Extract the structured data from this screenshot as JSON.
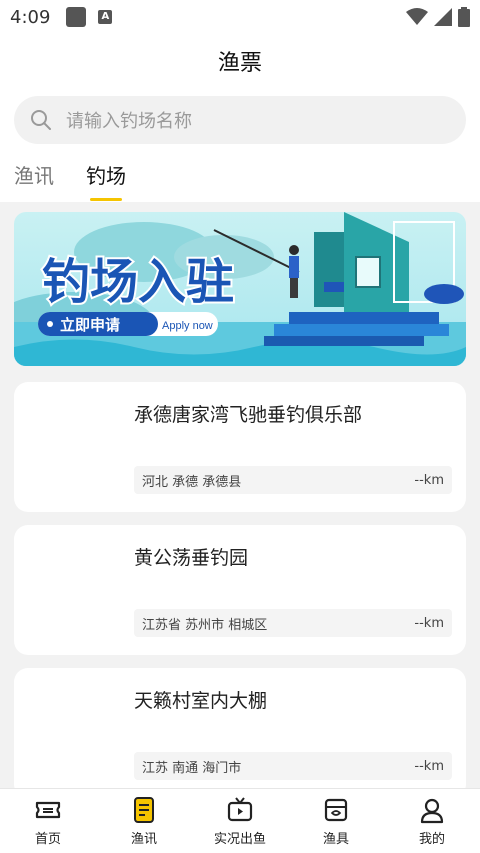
{
  "status": {
    "time": "4:09"
  },
  "header": {
    "title": "渔票"
  },
  "search": {
    "placeholder": "请输入钓场名称"
  },
  "tabs": [
    {
      "label": "渔讯"
    },
    {
      "label": "钓场"
    }
  ],
  "banner": {
    "headline": "钓场入驻",
    "button": "立即申请",
    "sub": "Apply now"
  },
  "venues": [
    {
      "name": "承德唐家湾飞驰垂钓俱乐部",
      "location": "河北 承德 承德县",
      "distance": "--km"
    },
    {
      "name": "黄公荡垂钓园",
      "location": "江苏省 苏州市 相城区",
      "distance": "--km"
    },
    {
      "name": "天籁村室内大棚",
      "location": "江苏 南通 海门市",
      "distance": "--km"
    }
  ],
  "nav": [
    {
      "label": "首页",
      "icon": "ticket-icon"
    },
    {
      "label": "渔讯",
      "icon": "news-icon"
    },
    {
      "label": "实况出鱼",
      "icon": "tv-icon"
    },
    {
      "label": "渔具",
      "icon": "box-icon"
    },
    {
      "label": "我的",
      "icon": "user-icon"
    }
  ],
  "colors": {
    "accent": "#f5c400"
  }
}
